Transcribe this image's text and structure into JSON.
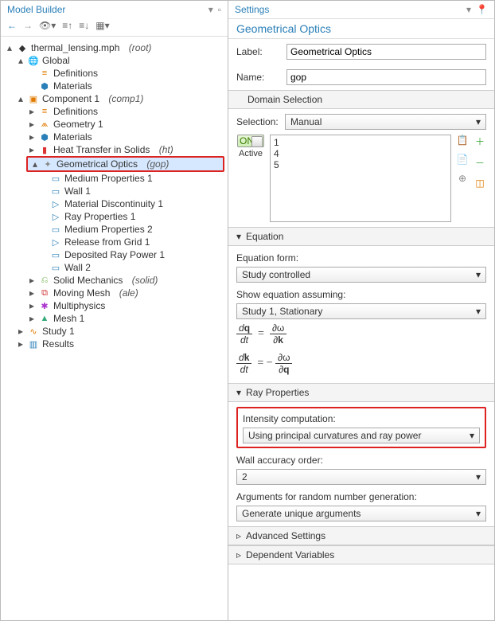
{
  "left": {
    "title": "Model Builder",
    "tree": {
      "root": "thermal_lensing.mph",
      "root_tag": "(root)",
      "global": "Global",
      "definitions": "Definitions",
      "materials": "Materials",
      "component": "Component 1",
      "component_tag": "(comp1)",
      "geometry": "Geometry 1",
      "ht": "Heat Transfer in Solids",
      "ht_tag": "(ht)",
      "gop": "Geometrical Optics",
      "gop_tag": "(gop)",
      "mp1": "Medium Properties 1",
      "wall1": "Wall 1",
      "md1": "Material Discontinuity 1",
      "rp1": "Ray Properties 1",
      "mp2": "Medium Properties 2",
      "rfg1": "Release from Grid 1",
      "drp1": "Deposited Ray Power 1",
      "wall2": "Wall 2",
      "solid": "Solid Mechanics",
      "solid_tag": "(solid)",
      "mm": "Moving Mesh",
      "mm_tag": "(ale)",
      "multi": "Multiphysics",
      "mesh": "Mesh 1",
      "study": "Study 1",
      "results": "Results"
    }
  },
  "right": {
    "title": "Settings",
    "subtitle": "Geometrical Optics",
    "label_lab": "Label:",
    "label_val": "Geometrical Optics",
    "name_lab": "Name:",
    "name_val": "gop",
    "domain_sel": "Domain Selection",
    "selection_lab": "Selection:",
    "selection_val": "Manual",
    "active": "Active",
    "switch": "ON",
    "list": [
      "1",
      "4",
      "5"
    ],
    "equation_hdr": "Equation",
    "eqform_lab": "Equation form:",
    "eqform_val": "Study controlled",
    "showassume_lab": "Show equation assuming:",
    "showassume_val": "Study 1, Stationary",
    "rayprops_hdr": "Ray Properties",
    "intensity_lab": "Intensity computation:",
    "intensity_val": "Using principal curvatures and ray power",
    "wallacc_lab": "Wall accuracy order:",
    "wallacc_val": "2",
    "rng_lab": "Arguments for random number generation:",
    "rng_val": "Generate unique arguments",
    "adv_hdr": "Advanced Settings",
    "dep_hdr": "Dependent Variables"
  }
}
